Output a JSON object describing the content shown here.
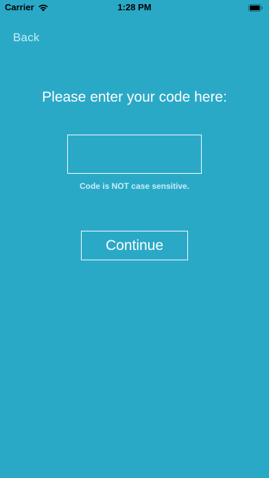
{
  "status_bar": {
    "carrier": "Carrier",
    "time": "1:28 PM",
    "wifi_icon": "wifi-icon",
    "battery_icon": "battery-icon"
  },
  "nav": {
    "back_label": "Back"
  },
  "main": {
    "title": "Please enter your code here:",
    "code_input_value": "",
    "code_hint": "Code is NOT case sensitive.",
    "continue_label": "Continue"
  },
  "colors": {
    "background": "#2aa9c7",
    "accent_text": "#c9eef8",
    "foreground": "#ffffff"
  }
}
